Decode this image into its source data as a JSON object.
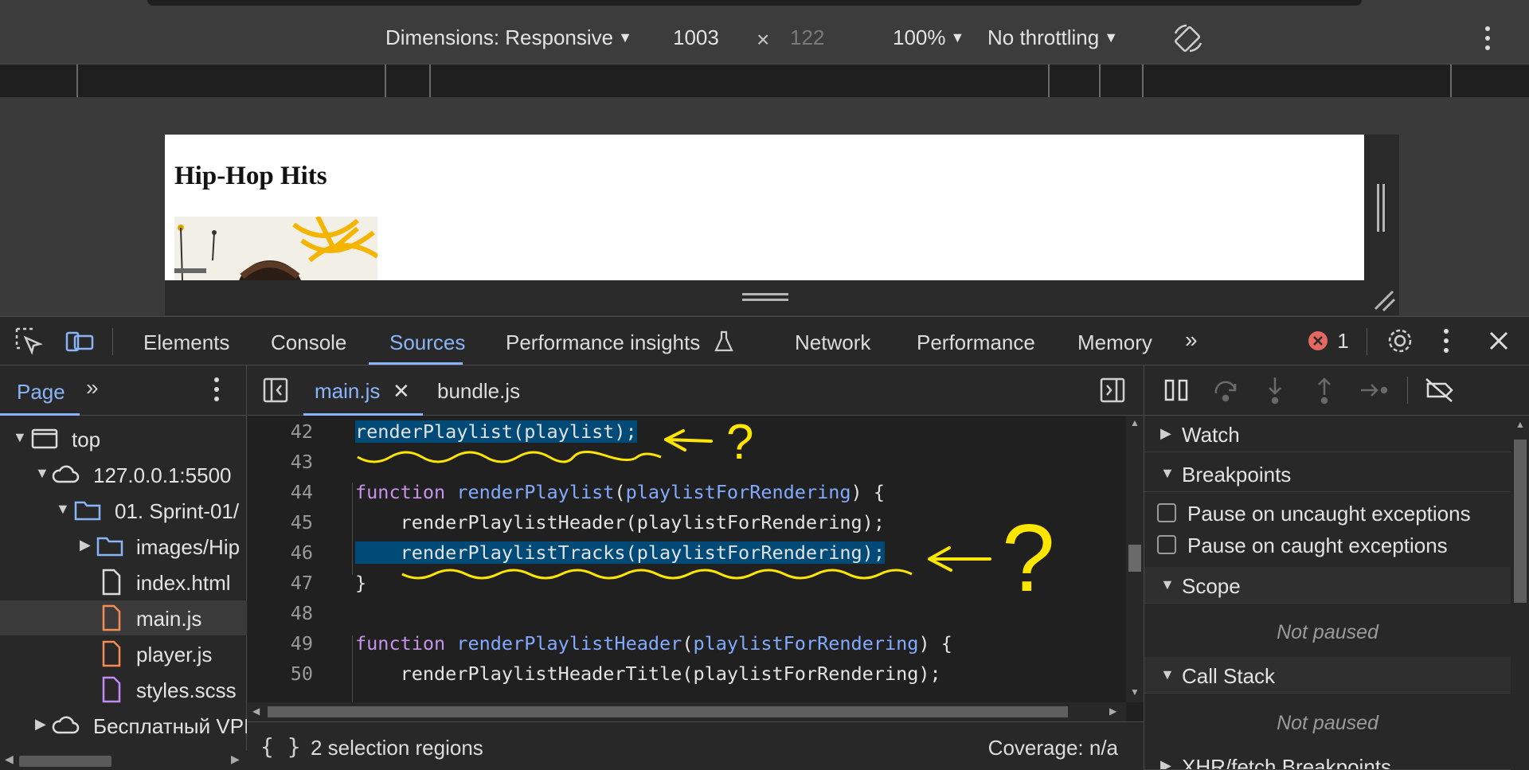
{
  "device_toolbar": {
    "dimensions_label": "Dimensions: Responsive",
    "width_value": "1003",
    "times_sign": "×",
    "height_value": "122",
    "zoom": "100%",
    "throttling": "No throttling"
  },
  "page_preview": {
    "heading": "Hip-Hop Hits"
  },
  "devtools_tabs": {
    "items": [
      "Elements",
      "Console",
      "Sources",
      "Performance insights",
      "Network",
      "Performance",
      "Memory"
    ],
    "active": "Sources",
    "error_count": "1"
  },
  "navigator": {
    "tab_label": "Page",
    "tree": [
      {
        "label": "top",
        "type": "frame"
      },
      {
        "label": "127.0.0.1:5500",
        "type": "cloud"
      },
      {
        "label": "01. Sprint-01/",
        "type": "folder-open"
      },
      {
        "label": "images/Hip",
        "type": "folder"
      },
      {
        "label": "index.html",
        "type": "file"
      },
      {
        "label": "main.js",
        "type": "js-file"
      },
      {
        "label": "player.js",
        "type": "js-file"
      },
      {
        "label": "styles.scss",
        "type": "css-file"
      },
      {
        "label": "Бесплатный VPI",
        "type": "cloud"
      }
    ]
  },
  "editor": {
    "tabs": [
      {
        "label": "main.js",
        "active": true
      },
      {
        "label": "bundle.js",
        "active": false
      }
    ],
    "lines": [
      {
        "num": "42",
        "text": "renderPlaylist(playlist);"
      },
      {
        "num": "43",
        "text": ""
      },
      {
        "num": "44",
        "text": "function renderPlaylist(playlistForRendering) {"
      },
      {
        "num": "45",
        "text": "    renderPlaylistHeader(playlistForRendering);"
      },
      {
        "num": "46",
        "text": "    renderPlaylistTracks(playlistForRendering);"
      },
      {
        "num": "47",
        "text": "}"
      },
      {
        "num": "48",
        "text": ""
      },
      {
        "num": "49",
        "text": "function renderPlaylistHeader(playlistForRendering) {"
      },
      {
        "num": "50",
        "text": "    renderPlaylistHeaderTitle(playlistForRendering);"
      }
    ],
    "status_selection": "2 selection regions",
    "status_coverage": "Coverage: n/a"
  },
  "debugger": {
    "watch": "Watch",
    "breakpoints": "Breakpoints",
    "pause_uncaught": "Pause on uncaught exceptions",
    "pause_caught": "Pause on caught exceptions",
    "scope": "Scope",
    "scope_status": "Not paused",
    "call_stack": "Call Stack",
    "call_stack_status": "Not paused",
    "xhr": "XHR/fetch Breakpoints"
  },
  "annotations": {
    "mark_1": "?",
    "mark_2": "?"
  },
  "colors": {
    "accent": "#8ab4f8",
    "selection": "#004a77",
    "keyword": "#c792ea",
    "function": "#82aaff",
    "error": "#e46962",
    "annotation": "#ffe600"
  }
}
